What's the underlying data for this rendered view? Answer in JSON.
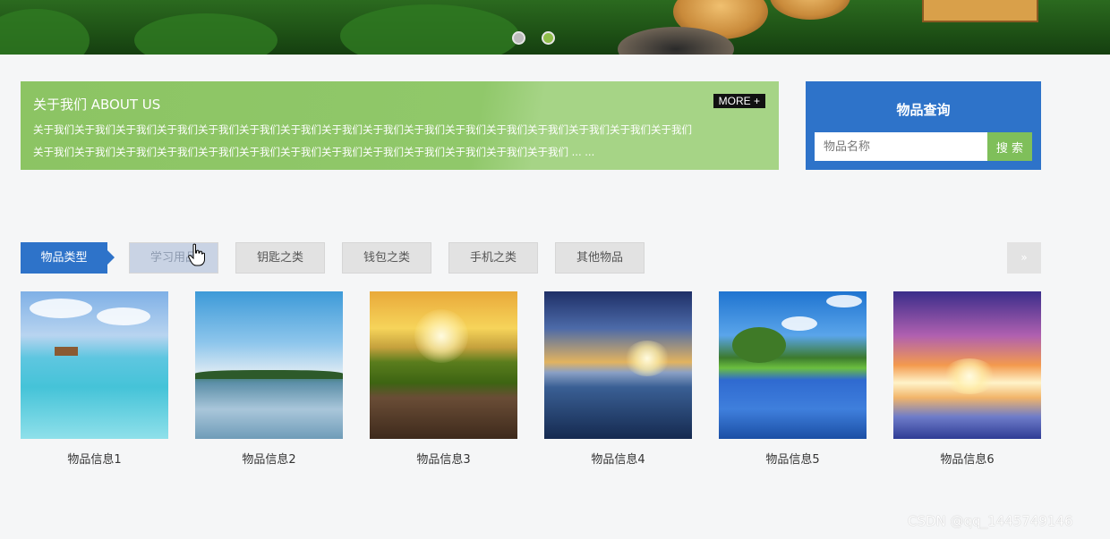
{
  "banner": {
    "dots": [
      "slide-1",
      "slide-2"
    ]
  },
  "about": {
    "title": "关于我们 ABOUT US",
    "more_label": "MORE +",
    "line1": "关于我们关于我们关于我们关于我们关于我们关于我们关于我们关于我们关于我们关于我们关于我们关于我们关于我们关于我们关于我们关于我们",
    "line2": "关于我们关于我们关于我们关于我们关于我们关于我们关于我们关于我们关于我们关于我们关于我们关于我们关于我们 ... ..."
  },
  "search": {
    "title": "物品查询",
    "placeholder": "物品名称",
    "button_label": "搜 索"
  },
  "categories": {
    "label": "物品类型",
    "tabs": [
      "学习用品",
      "钥匙之类",
      "钱包之类",
      "手机之类",
      "其他物品"
    ],
    "next_label": "»"
  },
  "items": [
    {
      "caption": "物品信息1"
    },
    {
      "caption": "物品信息2"
    },
    {
      "caption": "物品信息3"
    },
    {
      "caption": "物品信息4"
    },
    {
      "caption": "物品信息5"
    },
    {
      "caption": "物品信息6"
    }
  ],
  "watermark": "CSDN @qq_1445749146",
  "colors": {
    "primary_blue": "#2e73c9",
    "green": "#8cc463",
    "search_button": "#7fbf5a"
  }
}
